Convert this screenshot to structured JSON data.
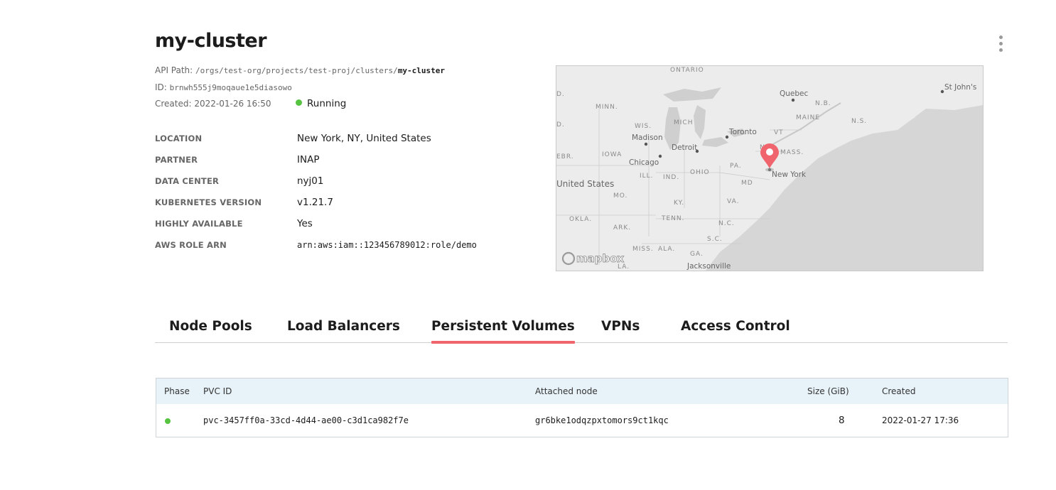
{
  "cluster": {
    "name": "my-cluster",
    "api_path_label": "API Path:",
    "api_path_prefix": "/orgs/test-org/projects/test-proj/clusters/",
    "api_path_name": "my-cluster",
    "id_label": "ID:",
    "id": "brnwh555j9moqaue1e5diasowo",
    "created": "Created: 2022-01-26 16:50",
    "status": "Running",
    "status_color": "#56c341"
  },
  "properties": [
    {
      "label": "LOCATION",
      "value": "New York, NY, United States"
    },
    {
      "label": "PARTNER",
      "value": "INAP"
    },
    {
      "label": "DATA CENTER",
      "value": "nyj01"
    },
    {
      "label": "KUBERNETES VERSION",
      "value": "v1.21.7"
    },
    {
      "label": "HIGHLY AVAILABLE",
      "value": "Yes"
    },
    {
      "label": "AWS ROLE ARN",
      "value": "arn:aws:iam::123456789012:role/demo"
    }
  ],
  "map": {
    "attribution": "mapbox",
    "marker_color": "#f0646d",
    "labels": {
      "ontario": "ONTARIO",
      "quebec": "Quebec",
      "st_johns": "St John's",
      "nb": "N.B.",
      "ns": "N.S.",
      "maine": "MAINE",
      "minn": "MINN.",
      "wis": "WIS.",
      "mich": "MICH",
      "madison": "Madison",
      "toronto": "Toronto",
      "vt": "VT",
      "iowa": "IOWA",
      "detroit": "Detroit",
      "ny": "N.Y.",
      "mass": "MASS.",
      "chicago": "Chicago",
      "pa": "PA.",
      "new_york": "New York",
      "ill": "ILL.",
      "ind": "IND.",
      "ohio": "OHIO",
      "united_states": "United States",
      "md": "MD",
      "mo": "MO.",
      "ky": "KY.",
      "va": "VA.",
      "okla": "OKLA.",
      "tenn": "TENN.",
      "nc": "N.C.",
      "ark": "ARK.",
      "sc": "S.C.",
      "miss": "MISS.",
      "ala": "ALA.",
      "ga": "GA.",
      "la": "LA.",
      "jacksonville": "Jacksonville",
      "d_left": "D.",
      "d_left2": "D.",
      "ebr": "EBR."
    }
  },
  "tabs": [
    {
      "label": "Node Pools",
      "active": false
    },
    {
      "label": "Load Balancers",
      "active": false
    },
    {
      "label": "Persistent Volumes",
      "active": true
    },
    {
      "label": "VPNs",
      "active": false
    },
    {
      "label": "Access Control",
      "active": false
    }
  ],
  "table": {
    "columns": [
      "Phase",
      "PVC ID",
      "Attached node",
      "Size (GiB)",
      "Created"
    ],
    "rows": [
      {
        "phase_color": "#56c341",
        "pvc_id": "pvc-3457ff0a-33cd-4d44-ae00-c3d1ca982f7e",
        "attached_node": "gr6bke1odqzpxtomors9ct1kqc",
        "size": "8",
        "created": "2022-01-27 17:36"
      }
    ]
  }
}
